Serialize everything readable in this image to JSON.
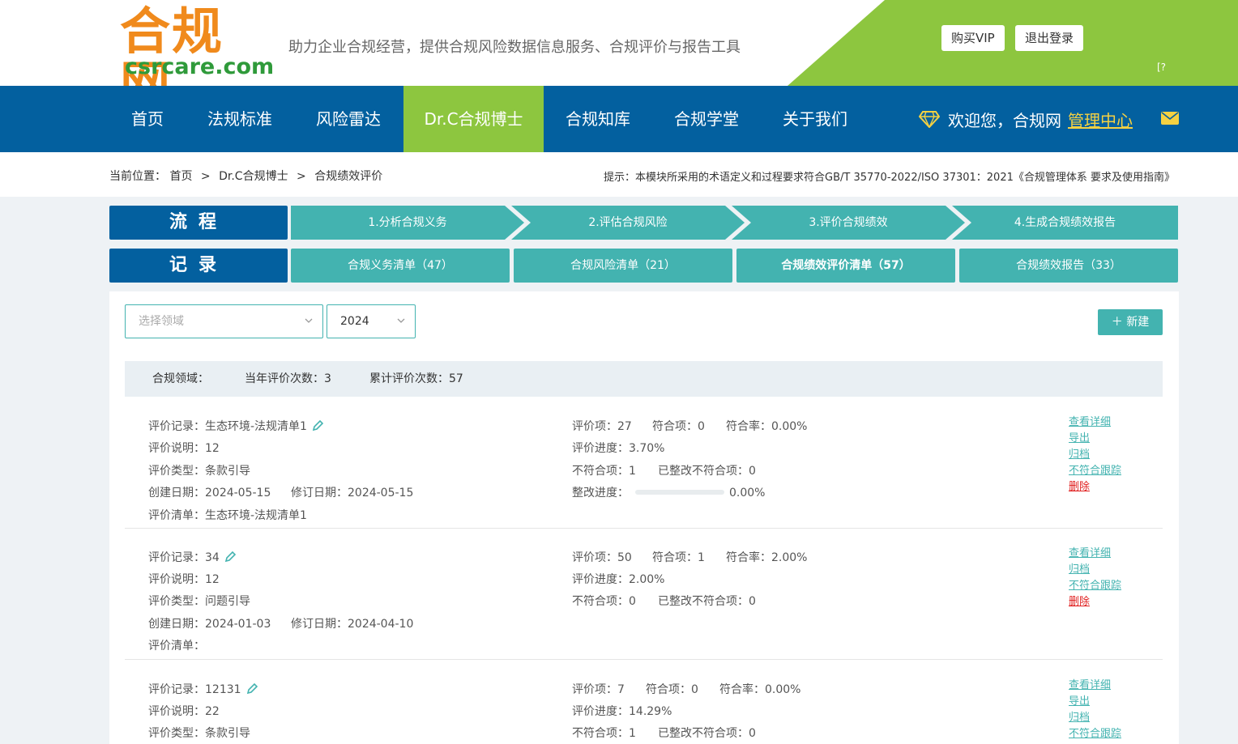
{
  "header": {
    "logo_cn": "合规网",
    "logo_en": "csrcare.com",
    "slogan": "助力企业合规经营，提供合规风险数据信息服务、合规评价与报告工具",
    "buy_vip": "购买VIP",
    "logout": "退出登录",
    "tiny_mark": "[?"
  },
  "nav": {
    "items": [
      "首页",
      "法规标准",
      "风险雷达",
      "Dr.C合规博士",
      "合规知库",
      "合规学堂",
      "关于我们"
    ],
    "active_index": 3,
    "welcome": "欢迎您，",
    "user": "合规网",
    "manage": "管理中心"
  },
  "breadcrumb": {
    "prefix": "当前位置：",
    "items": [
      "首页",
      "Dr.C合规博士",
      "合规绩效评价"
    ],
    "sep": ">",
    "hint": "提示：本模块所采用的术语定义和过程要求符合GB/T 35770-2022/ISO 37301：2021《合规管理体系 要求及使用指南》"
  },
  "flow": {
    "label": "流程",
    "steps": [
      "1.分析合规义务",
      "2.评估合规风险",
      "3.评价合规绩效",
      "4.生成合规绩效报告"
    ]
  },
  "records_tabs": {
    "label": "记录",
    "tabs": [
      "合规义务清单（47）",
      "合规风险清单（21）",
      "合规绩效评价清单（57）",
      "合规绩效报告（33）"
    ],
    "active_index": 2
  },
  "filters": {
    "domain_placeholder": "选择领域",
    "year": "2024",
    "new_button": "＋ 新建"
  },
  "summary": {
    "domain_label": "合规领域：",
    "year_count": "当年评价次数：3",
    "total_count": "累计评价次数：57"
  },
  "records": [
    {
      "record": "评价记录：生态环境-法规清单1",
      "desc": "评价说明：12",
      "type": "评价类型：条款引导",
      "created": "创建日期：2024-05-15",
      "revised": "修订日期：2024-05-15",
      "list": "评价清单：生态环境-法规清单1",
      "items": "评价项：27",
      "conform": "符合项：0",
      "rate": "符合率：0.00%",
      "progress": "评价进度：3.70%",
      "nonconform": "不符合项：1",
      "fixed": "已整改不符合项：0",
      "fix_progress_label": "整改进度：",
      "fix_progress_value": "0.00%",
      "fix_progress_fraction": 0,
      "actions": [
        "查看详细",
        "导出",
        "归档",
        "不符合跟踪",
        "删除"
      ]
    },
    {
      "record": "评价记录：34",
      "desc": "评价说明：12",
      "type": "评价类型：问题引导",
      "created": "创建日期：2024-01-03",
      "revised": "修订日期：2024-04-10",
      "list": "评价清单：",
      "items": "评价项：50",
      "conform": "符合项：1",
      "rate": "符合率：2.00%",
      "progress": "评价进度：2.00%",
      "nonconform": "不符合项：0",
      "fixed": "已整改不符合项：0",
      "actions": [
        "查看详细",
        "归档",
        "不符合跟踪",
        "删除"
      ]
    },
    {
      "record": "评价记录：12131",
      "desc": "评价说明：22",
      "type": "评价类型：条款引导",
      "items": "评价项：7",
      "conform": "符合项：0",
      "rate": "符合率：0.00%",
      "progress": "评价进度：14.29%",
      "nonconform": "不符合项：1",
      "fixed": "已整改不符合项：0",
      "actions": [
        "查看详细",
        "导出",
        "归档",
        "不符合跟踪"
      ]
    }
  ],
  "colors": {
    "nav_blue": "#03609f",
    "accent_green": "#8dc63f",
    "teal": "#43b3b0",
    "delete_red": "#e02020"
  }
}
